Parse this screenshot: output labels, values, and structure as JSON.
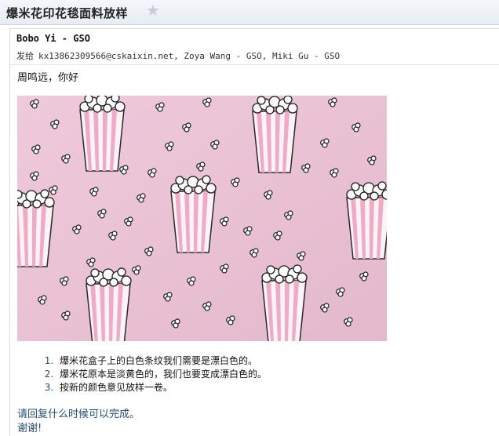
{
  "email": {
    "subject": "爆米花印花毯面料放样",
    "star_icon": "star-icon",
    "sender": "Bobo Yi - GSO",
    "recipients_label": "发给",
    "recipients": "kx13862309566@cskaixin.net, Zoya Wang - GSO, Miki Gu - GSO",
    "greeting": "周鸣远，你好",
    "list_items": [
      "爆米花盒子上的白色条纹我们需要是漂白色的。",
      "爆米花原本是淡黄色的，我们也要变成漂白色的。",
      "按新的颜色意见放样一卷。"
    ],
    "closing": "请回复什么时候可以完成。",
    "thanks": "谢谢!"
  },
  "colors": {
    "fabric_pink": "#ecc6d6",
    "stripe_pink": "#f2a9c4",
    "link_blue": "#1f4d7a"
  }
}
